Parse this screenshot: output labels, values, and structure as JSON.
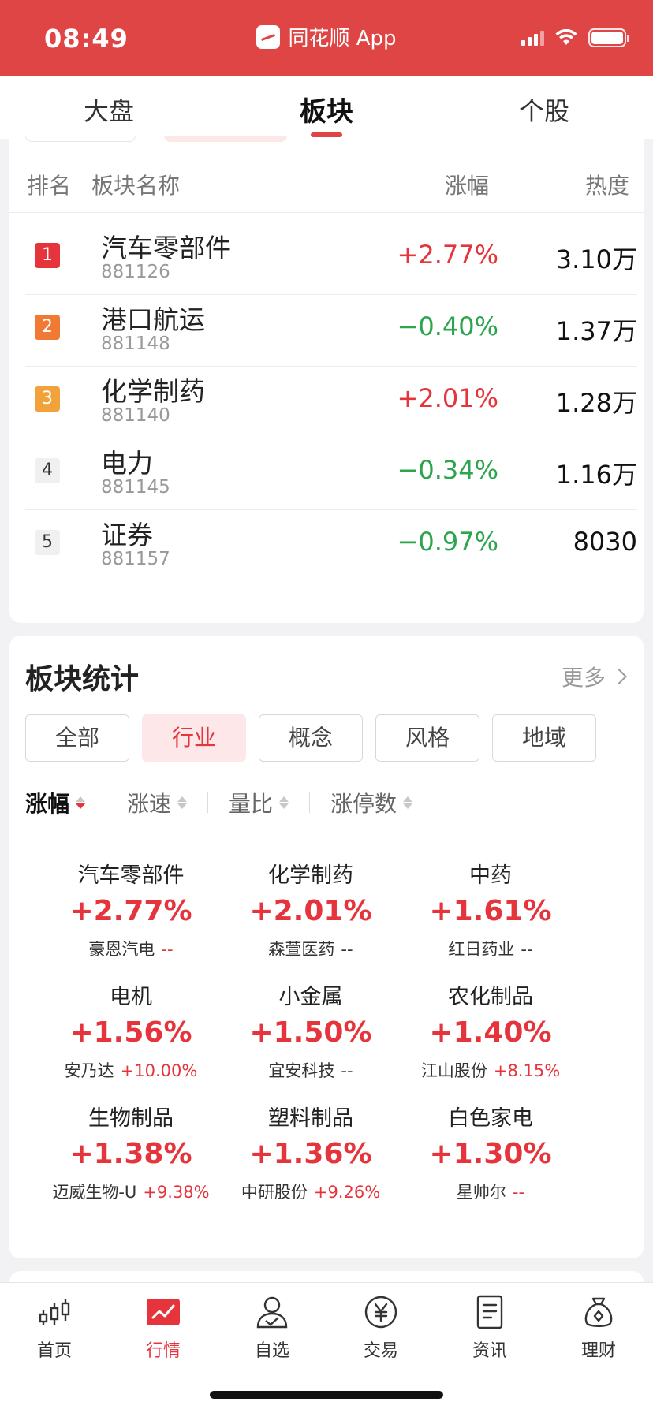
{
  "status_bar": {
    "time": "08:49",
    "app_name": "同花顺 App",
    "icons": [
      "signal-icon",
      "wifi-icon",
      "battery-icon"
    ]
  },
  "top_tabs": [
    {
      "label": "大盘",
      "active": false
    },
    {
      "label": "板块",
      "active": true
    },
    {
      "label": "个股",
      "active": false
    }
  ],
  "ranking": {
    "headers": {
      "rank": "排名",
      "name": "板块名称",
      "change": "涨幅",
      "heat": "热度"
    },
    "rows": [
      {
        "rank": "1",
        "name": "汽车零部件",
        "code": "881126",
        "change": "+2.77%",
        "direction": "up",
        "heat": "3.10万",
        "badge_color": "#e5343b"
      },
      {
        "rank": "2",
        "name": "港口航运",
        "code": "881148",
        "change": "−0.40%",
        "direction": "down",
        "heat": "1.37万",
        "badge_color": "#f07a33"
      },
      {
        "rank": "3",
        "name": "化学制药",
        "code": "881140",
        "change": "+2.01%",
        "direction": "up",
        "heat": "1.28万",
        "badge_color": "#f2a23a"
      },
      {
        "rank": "4",
        "name": "电力",
        "code": "881145",
        "change": "−0.34%",
        "direction": "down",
        "heat": "1.16万",
        "badge_color": ""
      },
      {
        "rank": "5",
        "name": "证券",
        "code": "881157",
        "change": "−0.97%",
        "direction": "down",
        "heat": "8030",
        "badge_color": ""
      }
    ]
  },
  "stats": {
    "title": "板块统计",
    "more": "更多",
    "filters": [
      {
        "label": "全部",
        "active": false
      },
      {
        "label": "行业",
        "active": true
      },
      {
        "label": "概念",
        "active": false
      },
      {
        "label": "风格",
        "active": false
      },
      {
        "label": "地域",
        "active": false
      }
    ],
    "sorts": [
      {
        "label": "涨幅",
        "active": true
      },
      {
        "label": "涨速",
        "active": false
      },
      {
        "label": "量比",
        "active": false
      },
      {
        "label": "涨停数",
        "active": false
      }
    ],
    "cells": [
      {
        "name": "汽车零部件",
        "pct": "+2.77%",
        "leader": "豪恩汽电",
        "leader_pct": "--",
        "leader_style": "rdash"
      },
      {
        "name": "化学制药",
        "pct": "+2.01%",
        "leader": "森萱医药",
        "leader_pct": "--",
        "leader_style": "dash"
      },
      {
        "name": "中药",
        "pct": "+1.61%",
        "leader": "红日药业",
        "leader_pct": "--",
        "leader_style": "dash"
      },
      {
        "name": "电机",
        "pct": "+1.56%",
        "leader": "安乃达",
        "leader_pct": "+10.00%",
        "leader_style": "up"
      },
      {
        "name": "小金属",
        "pct": "+1.50%",
        "leader": "宜安科技",
        "leader_pct": "--",
        "leader_style": "dash"
      },
      {
        "name": "农化制品",
        "pct": "+1.40%",
        "leader": "江山股份",
        "leader_pct": "+8.15%",
        "leader_style": "up"
      },
      {
        "name": "生物制品",
        "pct": "+1.38%",
        "leader": "迈威生物-U",
        "leader_pct": "+9.38%",
        "leader_style": "up"
      },
      {
        "name": "塑料制品",
        "pct": "+1.36%",
        "leader": "中研股份",
        "leader_pct": "+9.26%",
        "leader_style": "up"
      },
      {
        "name": "白色家电",
        "pct": "+1.30%",
        "leader": "星帅尔",
        "leader_pct": "--",
        "leader_style": "rdash"
      }
    ]
  },
  "bottom_nav": [
    {
      "label": "首页",
      "icon": "candlestick-icon",
      "active": false
    },
    {
      "label": "行情",
      "icon": "market-chart-icon",
      "active": true
    },
    {
      "label": "自选",
      "icon": "user-check-icon",
      "active": false
    },
    {
      "label": "交易",
      "icon": "yuan-coin-icon",
      "active": false
    },
    {
      "label": "资讯",
      "icon": "document-icon",
      "active": false
    },
    {
      "label": "理财",
      "icon": "money-bag-icon",
      "active": false
    }
  ],
  "colors": {
    "brand_red": "#e04545",
    "up": "#e5343b",
    "down": "#2da44e"
  }
}
